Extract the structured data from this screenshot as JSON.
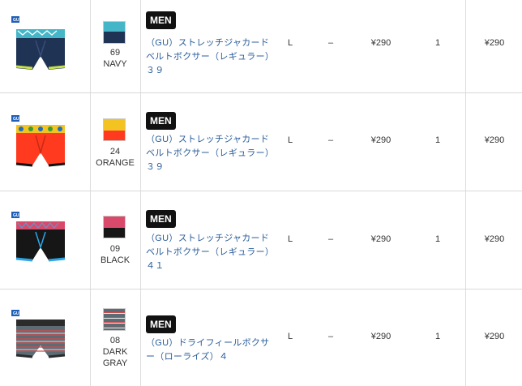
{
  "rows": [
    {
      "color_code": "69",
      "color_name": "NAVY",
      "badge": "MEN",
      "product_name": "（GU）ストレッチジャカードベルトボクサー（レギュラー）３９",
      "size": "L",
      "dash": "–",
      "price": "¥290",
      "qty": "1",
      "subtotal": "¥290",
      "brand": "GU",
      "colors": {
        "body": "#1f3355",
        "band": "#44b6c8",
        "trim": "#c8e04a"
      }
    },
    {
      "color_code": "24",
      "color_name": "ORANGE",
      "badge": "MEN",
      "product_name": "（GU）ストレッチジャカードベルトボクサー（レギュラー）３９",
      "size": "L",
      "dash": "–",
      "price": "¥290",
      "qty": "1",
      "subtotal": "¥290",
      "brand": "GU",
      "colors": {
        "body": "#ff3a1f",
        "band": "#f3c322",
        "trim": "#111111"
      }
    },
    {
      "color_code": "09",
      "color_name": "BLACK",
      "badge": "MEN",
      "product_name": "（GU）ストレッチジャカードベルトボクサー（レギュラー）４１",
      "size": "L",
      "dash": "–",
      "price": "¥290",
      "qty": "1",
      "subtotal": "¥290",
      "brand": "GU",
      "colors": {
        "body": "#161616",
        "band": "#d94a6a",
        "trim": "#2aa6e8"
      }
    },
    {
      "color_code": "08",
      "color_name": "DARK GRAY",
      "badge": "MEN",
      "product_name": "（GU）ドライフィールボクサー（ローライズ）４",
      "size": "L",
      "dash": "–",
      "price": "¥290",
      "qty": "1",
      "subtotal": "¥290",
      "brand": "GU",
      "colors": {
        "body": "#5c6b74",
        "band": "#2b2b2b",
        "trim": "#d84a4a"
      }
    }
  ]
}
